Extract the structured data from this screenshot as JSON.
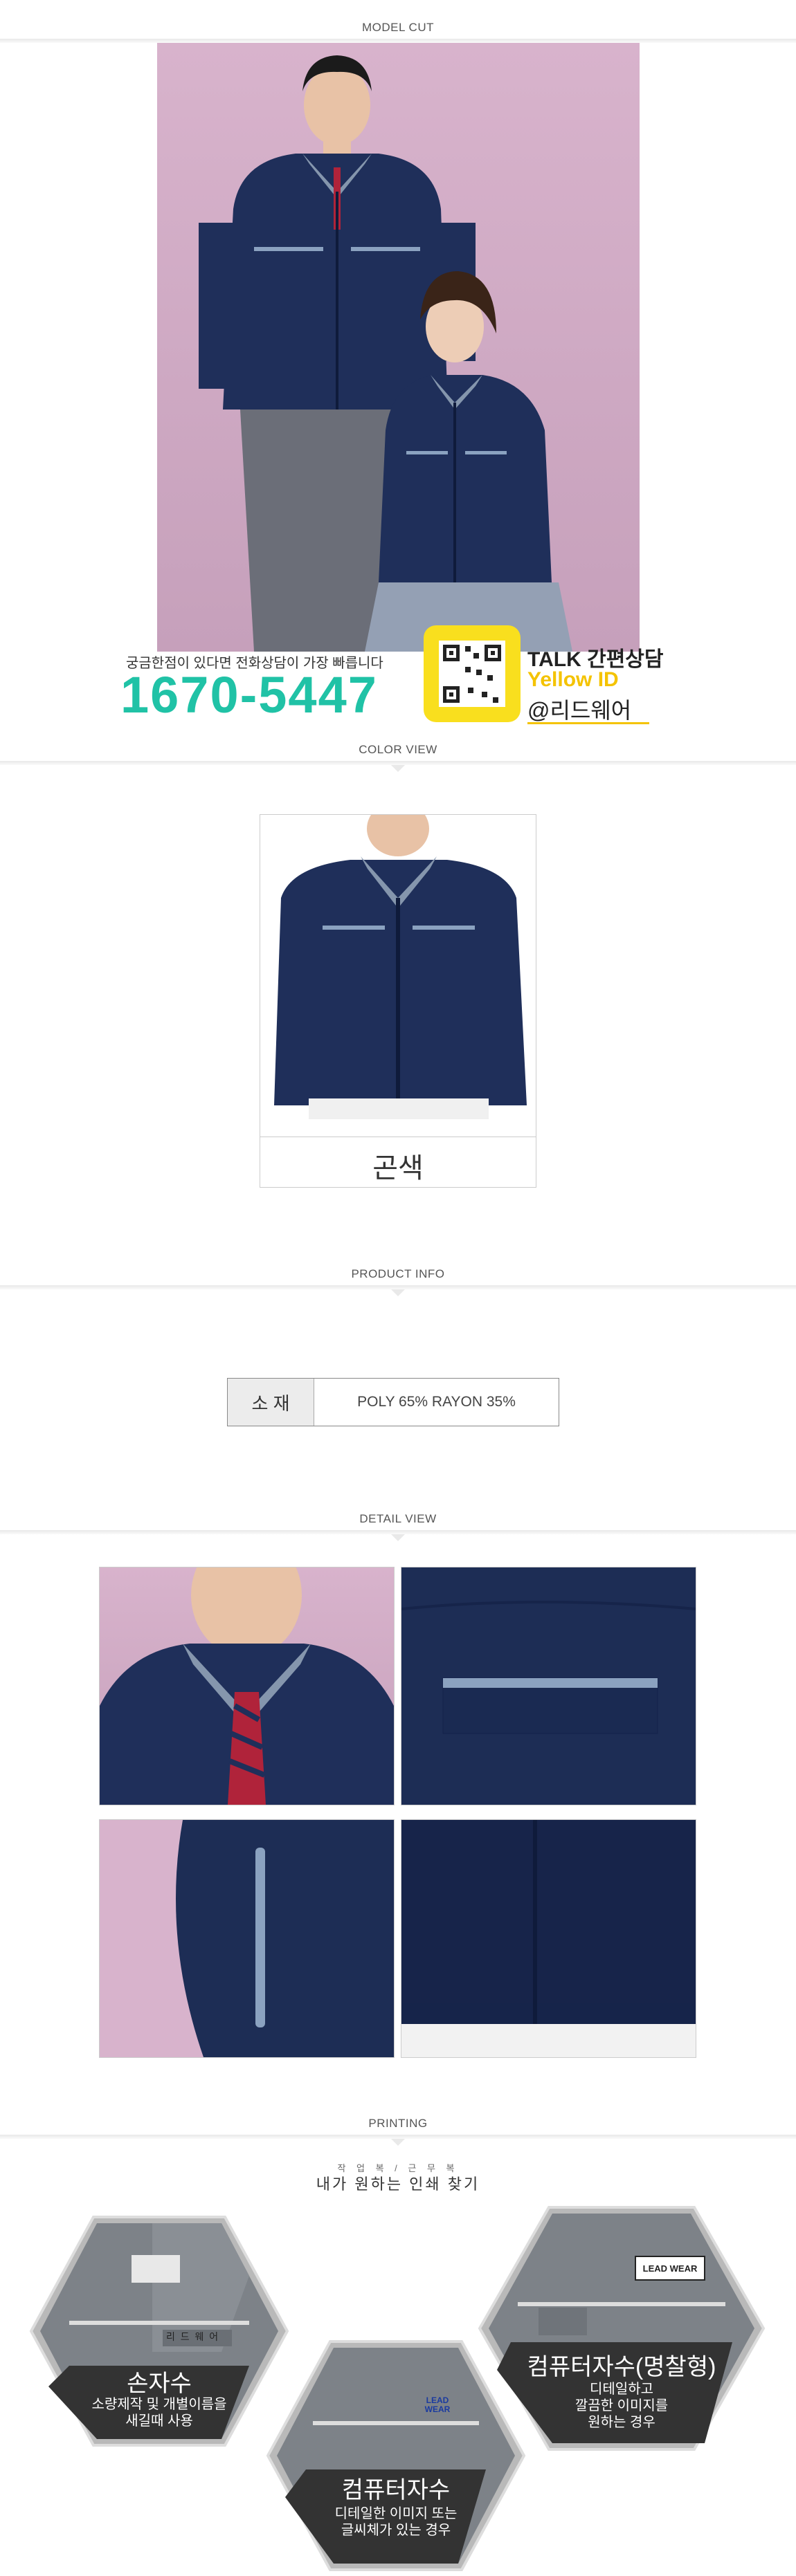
{
  "sections": {
    "model_cut": "MODEL CUT",
    "color_view": "COLOR VIEW",
    "product_info": "PRODUCT INFO",
    "detail_view": "DETAIL VIEW",
    "printing": "PRINTING"
  },
  "contact": {
    "note": "궁금한점이 있다면 전화상담이 가장 빠릅니다",
    "phone": "1670-5447",
    "talk": "TALK 간편상담",
    "yellow_id": "Yellow ID",
    "handle": "@리드웨어"
  },
  "color_view": {
    "color_name": "곤색"
  },
  "product_info": {
    "material_label": "소 재",
    "material_value": "POLY 65% RAYON 35%"
  },
  "printing": {
    "subtitle": "작 업 복 / 근 무 복",
    "title": "내가 원하는 인쇄 찾기",
    "options": [
      {
        "name": "손자수",
        "desc1": "소량제작 및 개별이름을",
        "desc2": "새길때 사용",
        "badge": "리 드 웨 어"
      },
      {
        "name": "컴퓨터자수",
        "desc1": "디테일한 이미지 또는",
        "desc2": "글씨체가 있는 경우",
        "badge": "LEAD WEAR"
      },
      {
        "name": "컴퓨터자수(명찰형)",
        "desc1": "디테일하고",
        "desc2": "깔끔한 이미지를",
        "desc3": "원하는 경우",
        "badge": "LEAD WEAR"
      }
    ]
  },
  "colors": {
    "accent": "#20c2a6",
    "navy": "#1d2d55",
    "kakao": "#f9df1e"
  }
}
